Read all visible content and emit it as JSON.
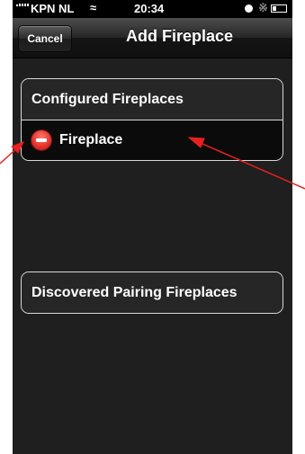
{
  "status_bar": {
    "carrier": "KPN NL",
    "time": "20:34",
    "wifi_icon": "wifi-icon",
    "lock_icon": "rotation-lock-icon",
    "bluetooth_icon": "bluetooth-icon",
    "battery_icon": "battery-icon"
  },
  "navbar": {
    "cancel_label": "Cancel",
    "title": "Add Fireplace"
  },
  "configured": {
    "header": "Configured Fireplaces",
    "items": [
      {
        "label": "Fireplace",
        "icon": "delete-minus-icon"
      }
    ]
  },
  "discovered": {
    "header": "Discovered Pairing Fireplaces"
  },
  "annotations": {
    "arrow_color": "#e8201e"
  },
  "colors": {
    "background": "#1f1f1f",
    "delete_red": "#e2302a"
  }
}
